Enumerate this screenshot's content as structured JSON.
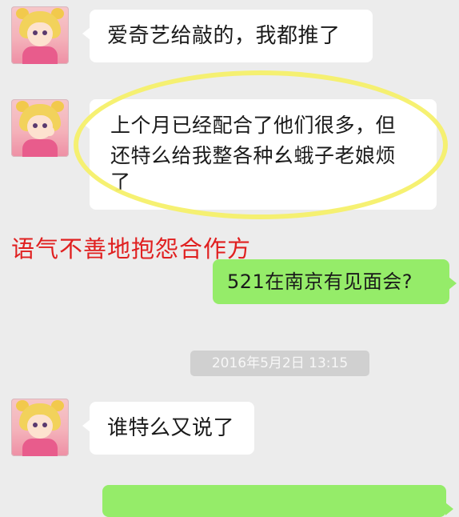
{
  "messages": [
    {
      "side": "left",
      "avatar": "sailor-moon-avatar",
      "text": "爱奇艺给敲的，我都推了"
    },
    {
      "side": "left",
      "avatar": "sailor-moon-avatar",
      "line1": "上个月已经配合了他们很多，但",
      "line2": "还特么给我整各种幺蛾子老娘烦",
      "line3": "了"
    },
    {
      "side": "right",
      "text": "521在南京有见面会?"
    },
    {
      "side": "left",
      "avatar": "sailor-moon-avatar",
      "text": "谁特么又说了"
    }
  ],
  "annotation": {
    "text": "语气不善地抱怨合作方",
    "color": "#e02020"
  },
  "timestamp": "2016年5月2日 13:15",
  "colors": {
    "background": "#ececec",
    "incoming_bubble": "#ffffff",
    "outgoing_bubble": "#95ec69",
    "highlight": "#f5f06a"
  }
}
